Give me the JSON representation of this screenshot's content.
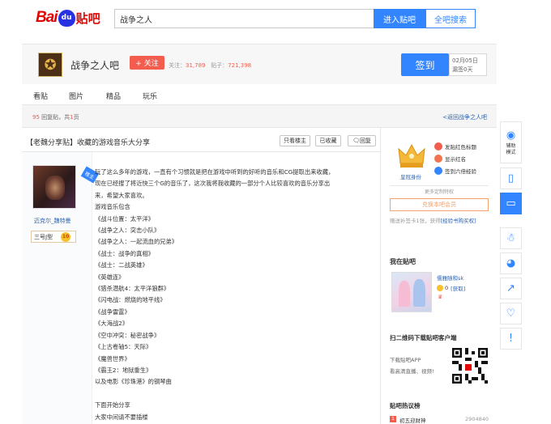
{
  "topbar": {
    "logo_bai": "Bai",
    "logo_du": "du",
    "logo_tieba": "贴吧",
    "search_value": "战争之人",
    "enter_label": "进入贴吧",
    "allsearch_label": "全吧搜索"
  },
  "forum": {
    "name": "战争之人吧",
    "follow_label": "+ 关注",
    "follow_text": "关注：",
    "follow_count": "31,789",
    "post_text": "贴子：",
    "post_count": "721,398",
    "signin_label": "签到",
    "signin_date": "02月05日",
    "signin_days": "漏签0天"
  },
  "tabs": [
    "看贴",
    "图片",
    "精品",
    "玩乐"
  ],
  "thread": {
    "reply_num": "95",
    "reply_text": "回复贴，共",
    "page_num": "1",
    "page_text": "页",
    "back_link": "<返回战争之人吧",
    "title": "【老魏分享贴】收藏的游戏音乐大分享",
    "btn_author_only": "只看楼主",
    "btn_collect": "已收藏",
    "btn_reply": "回复"
  },
  "author": {
    "badge": "楼主",
    "name": "迈克尔_魏特曼",
    "level_label": "三号J型",
    "level_num": "10"
  },
  "post_lines": [
    "玩了这么多年的游戏，一直有个习惯就是把在游戏中听到的好听的音乐和CG提取出来收藏，",
    "现在已经搜了将近快三个G的音乐了，这次我将我收藏的一部分个人比较喜欢的音乐分享出",
    "来，希望大家喜欢。",
    "游戏音乐包含",
    "《战斗位置：太平洋》",
    "《战争之人：突击小队》",
    "《战争之人：一起流血的兄弟》",
    "《战士：战争的真相》",
    "《战士：二战英雄》",
    "《英雄连》",
    "《猎杀潜航4：太平洋狼群》",
    "《闪电战：燃烧的地平线》",
    "《战争雷霆》",
    "《大海战2》",
    "《空中冲突：秘密战争》",
    "《上古卷轴5：天际》",
    "《魔兽世界》",
    "《霸王2：地狱重生》",
    "以及电影《珍珠港》的钢琴曲",
    "",
    "下面开始分享",
    "大家中间请不要插楼"
  ],
  "sidebar": {
    "crown_label": "皇冠身份",
    "priv1": "发贴红色标题",
    "priv2": "显示红名",
    "priv3": "签到六倍经验",
    "more_priv": "更多定制特权",
    "vip_btn": "兑换本吧会员",
    "tcard_text": "赠送补签卡1张，获得",
    "tcard_link": "[经验书购买权]",
    "mybar_title": "我在贴吧",
    "mybar_user": "儒雅随和sk",
    "mybar_coin_num": "0",
    "mybar_coin_link": "[获取]",
    "qr_title": "扫二维码下载贴吧客户端",
    "qr_line1": "下载贴吧APP",
    "qr_line2": "看高清直播、视频!",
    "hot_title": "贴吧热议榜",
    "hot_rank": "1",
    "hot_item": "初五迎财神",
    "hot_count": "2904840"
  },
  "side_tools": {
    "assist_label1": "辅助",
    "assist_label2": "模式"
  },
  "colors": {
    "brand_blue": "#3385ff",
    "follow_red": "#f25d4e",
    "link_blue": "#2d64b3"
  }
}
